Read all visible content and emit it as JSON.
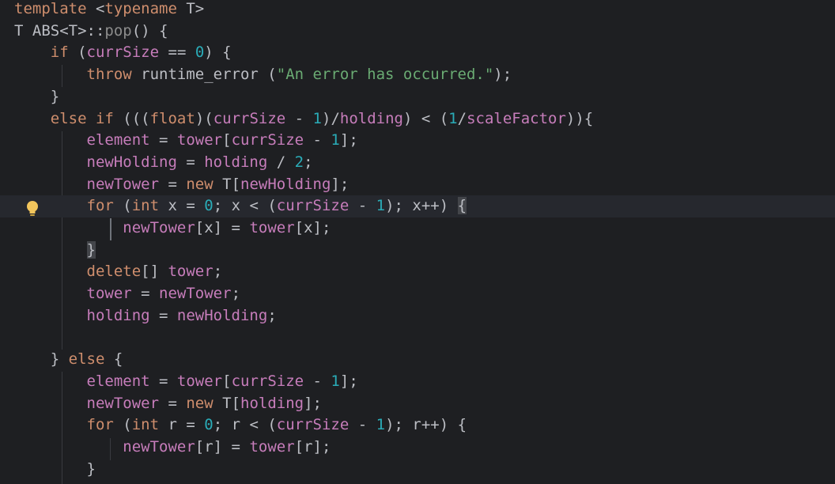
{
  "editor": {
    "lines": [
      [
        {
          "t": "template",
          "c": "kw"
        },
        {
          "t": " <",
          "c": "op"
        },
        {
          "t": "typename",
          "c": "kw"
        },
        {
          "t": " T>",
          "c": "plain"
        }
      ],
      [
        {
          "t": "T ",
          "c": "plain"
        },
        {
          "t": "ABS",
          "c": "plain"
        },
        {
          "t": "<T>::",
          "c": "plain"
        },
        {
          "t": "pop",
          "c": "pop"
        },
        {
          "t": "() {",
          "c": "plain"
        }
      ],
      [
        {
          "t": "    ",
          "c": "plain"
        },
        {
          "t": "if",
          "c": "kw"
        },
        {
          "t": " (",
          "c": "plain"
        },
        {
          "t": "currSize",
          "c": "field"
        },
        {
          "t": " == ",
          "c": "op"
        },
        {
          "t": "0",
          "c": "num"
        },
        {
          "t": ") {",
          "c": "plain"
        }
      ],
      [
        {
          "t": "        ",
          "c": "plain"
        },
        {
          "t": "throw",
          "c": "kw"
        },
        {
          "t": " runtime_error (",
          "c": "plain"
        },
        {
          "t": "\"An error has occurred.\"",
          "c": "str"
        },
        {
          "t": ");",
          "c": "plain"
        }
      ],
      [
        {
          "t": "    }",
          "c": "plain"
        }
      ],
      [
        {
          "t": "    ",
          "c": "plain"
        },
        {
          "t": "else if",
          "c": "kw"
        },
        {
          "t": " (((",
          "c": "plain"
        },
        {
          "t": "float",
          "c": "kw"
        },
        {
          "t": ")(",
          "c": "plain"
        },
        {
          "t": "currSize",
          "c": "field"
        },
        {
          "t": " - ",
          "c": "op"
        },
        {
          "t": "1",
          "c": "num"
        },
        {
          "t": ")/",
          "c": "plain"
        },
        {
          "t": "holding",
          "c": "field"
        },
        {
          "t": ") < (",
          "c": "plain"
        },
        {
          "t": "1",
          "c": "num"
        },
        {
          "t": "/",
          "c": "plain"
        },
        {
          "t": "scaleFactor",
          "c": "field"
        },
        {
          "t": ")){",
          "c": "plain"
        }
      ],
      [
        {
          "t": "        ",
          "c": "plain"
        },
        {
          "t": "element",
          "c": "field"
        },
        {
          "t": " = ",
          "c": "op"
        },
        {
          "t": "tower",
          "c": "field"
        },
        {
          "t": "[",
          "c": "plain"
        },
        {
          "t": "currSize",
          "c": "field"
        },
        {
          "t": " - ",
          "c": "op"
        },
        {
          "t": "1",
          "c": "num"
        },
        {
          "t": "];",
          "c": "plain"
        }
      ],
      [
        {
          "t": "        ",
          "c": "plain"
        },
        {
          "t": "newHolding",
          "c": "field"
        },
        {
          "t": " = ",
          "c": "op"
        },
        {
          "t": "holding",
          "c": "field"
        },
        {
          "t": " / ",
          "c": "op"
        },
        {
          "t": "2",
          "c": "num"
        },
        {
          "t": ";",
          "c": "plain"
        }
      ],
      [
        {
          "t": "        ",
          "c": "plain"
        },
        {
          "t": "newTower",
          "c": "field"
        },
        {
          "t": " = ",
          "c": "op"
        },
        {
          "t": "new",
          "c": "kw"
        },
        {
          "t": " T[",
          "c": "plain"
        },
        {
          "t": "newHolding",
          "c": "field"
        },
        {
          "t": "];",
          "c": "plain"
        }
      ],
      [
        {
          "t": "        ",
          "c": "plain"
        },
        {
          "t": "for",
          "c": "kw"
        },
        {
          "t": " (",
          "c": "plain"
        },
        {
          "t": "int",
          "c": "kw"
        },
        {
          "t": " x = ",
          "c": "plain"
        },
        {
          "t": "0",
          "c": "num"
        },
        {
          "t": "; x < (",
          "c": "plain"
        },
        {
          "t": "currSize",
          "c": "field"
        },
        {
          "t": " - ",
          "c": "op"
        },
        {
          "t": "1",
          "c": "num"
        },
        {
          "t": "); x++) ",
          "c": "plain"
        },
        {
          "t": "{",
          "c": "match"
        }
      ],
      [
        {
          "t": "            ",
          "c": "plain"
        },
        {
          "t": "newTower",
          "c": "field"
        },
        {
          "t": "[x] = ",
          "c": "plain"
        },
        {
          "t": "tower",
          "c": "field"
        },
        {
          "t": "[x];",
          "c": "plain"
        }
      ],
      [
        {
          "t": "        ",
          "c": "plain"
        },
        {
          "t": "}",
          "c": "match"
        }
      ],
      [
        {
          "t": "        ",
          "c": "plain"
        },
        {
          "t": "delete",
          "c": "kw"
        },
        {
          "t": "[] ",
          "c": "plain"
        },
        {
          "t": "tower",
          "c": "field"
        },
        {
          "t": ";",
          "c": "plain"
        }
      ],
      [
        {
          "t": "        ",
          "c": "plain"
        },
        {
          "t": "tower",
          "c": "field"
        },
        {
          "t": " = ",
          "c": "op"
        },
        {
          "t": "newTower",
          "c": "field"
        },
        {
          "t": ";",
          "c": "plain"
        }
      ],
      [
        {
          "t": "        ",
          "c": "plain"
        },
        {
          "t": "holding",
          "c": "field"
        },
        {
          "t": " = ",
          "c": "op"
        },
        {
          "t": "newHolding",
          "c": "field"
        },
        {
          "t": ";",
          "c": "plain"
        }
      ],
      [],
      [
        {
          "t": "    } ",
          "c": "plain"
        },
        {
          "t": "else",
          "c": "kw"
        },
        {
          "t": " {",
          "c": "plain"
        }
      ],
      [
        {
          "t": "        ",
          "c": "plain"
        },
        {
          "t": "element",
          "c": "field"
        },
        {
          "t": " = ",
          "c": "op"
        },
        {
          "t": "tower",
          "c": "field"
        },
        {
          "t": "[",
          "c": "plain"
        },
        {
          "t": "currSize",
          "c": "field"
        },
        {
          "t": " - ",
          "c": "op"
        },
        {
          "t": "1",
          "c": "num"
        },
        {
          "t": "];",
          "c": "plain"
        }
      ],
      [
        {
          "t": "        ",
          "c": "plain"
        },
        {
          "t": "newTower",
          "c": "field"
        },
        {
          "t": " = ",
          "c": "op"
        },
        {
          "t": "new",
          "c": "kw"
        },
        {
          "t": " T[",
          "c": "plain"
        },
        {
          "t": "holding",
          "c": "field"
        },
        {
          "t": "];",
          "c": "plain"
        }
      ],
      [
        {
          "t": "        ",
          "c": "plain"
        },
        {
          "t": "for",
          "c": "kw"
        },
        {
          "t": " (",
          "c": "plain"
        },
        {
          "t": "int",
          "c": "kw"
        },
        {
          "t": " r = ",
          "c": "plain"
        },
        {
          "t": "0",
          "c": "num"
        },
        {
          "t": "; r < (",
          "c": "plain"
        },
        {
          "t": "currSize",
          "c": "field"
        },
        {
          "t": " - ",
          "c": "op"
        },
        {
          "t": "1",
          "c": "num"
        },
        {
          "t": "); r++) {",
          "c": "plain"
        }
      ],
      [
        {
          "t": "            ",
          "c": "plain"
        },
        {
          "t": "newTower",
          "c": "field"
        },
        {
          "t": "[r] = ",
          "c": "plain"
        },
        {
          "t": "tower",
          "c": "field"
        },
        {
          "t": "[r];",
          "c": "plain"
        }
      ],
      [
        {
          "t": "        }",
          "c": "plain"
        }
      ]
    ],
    "highlighted_line": 10,
    "gutter_icon": "lightbulb-icon",
    "colors": {
      "background": "#1e1f22",
      "keyword": "#cf8e6d",
      "field": "#c77dbb",
      "number": "#2aacb8",
      "string": "#6aab73",
      "text": "#bcbec4"
    }
  }
}
